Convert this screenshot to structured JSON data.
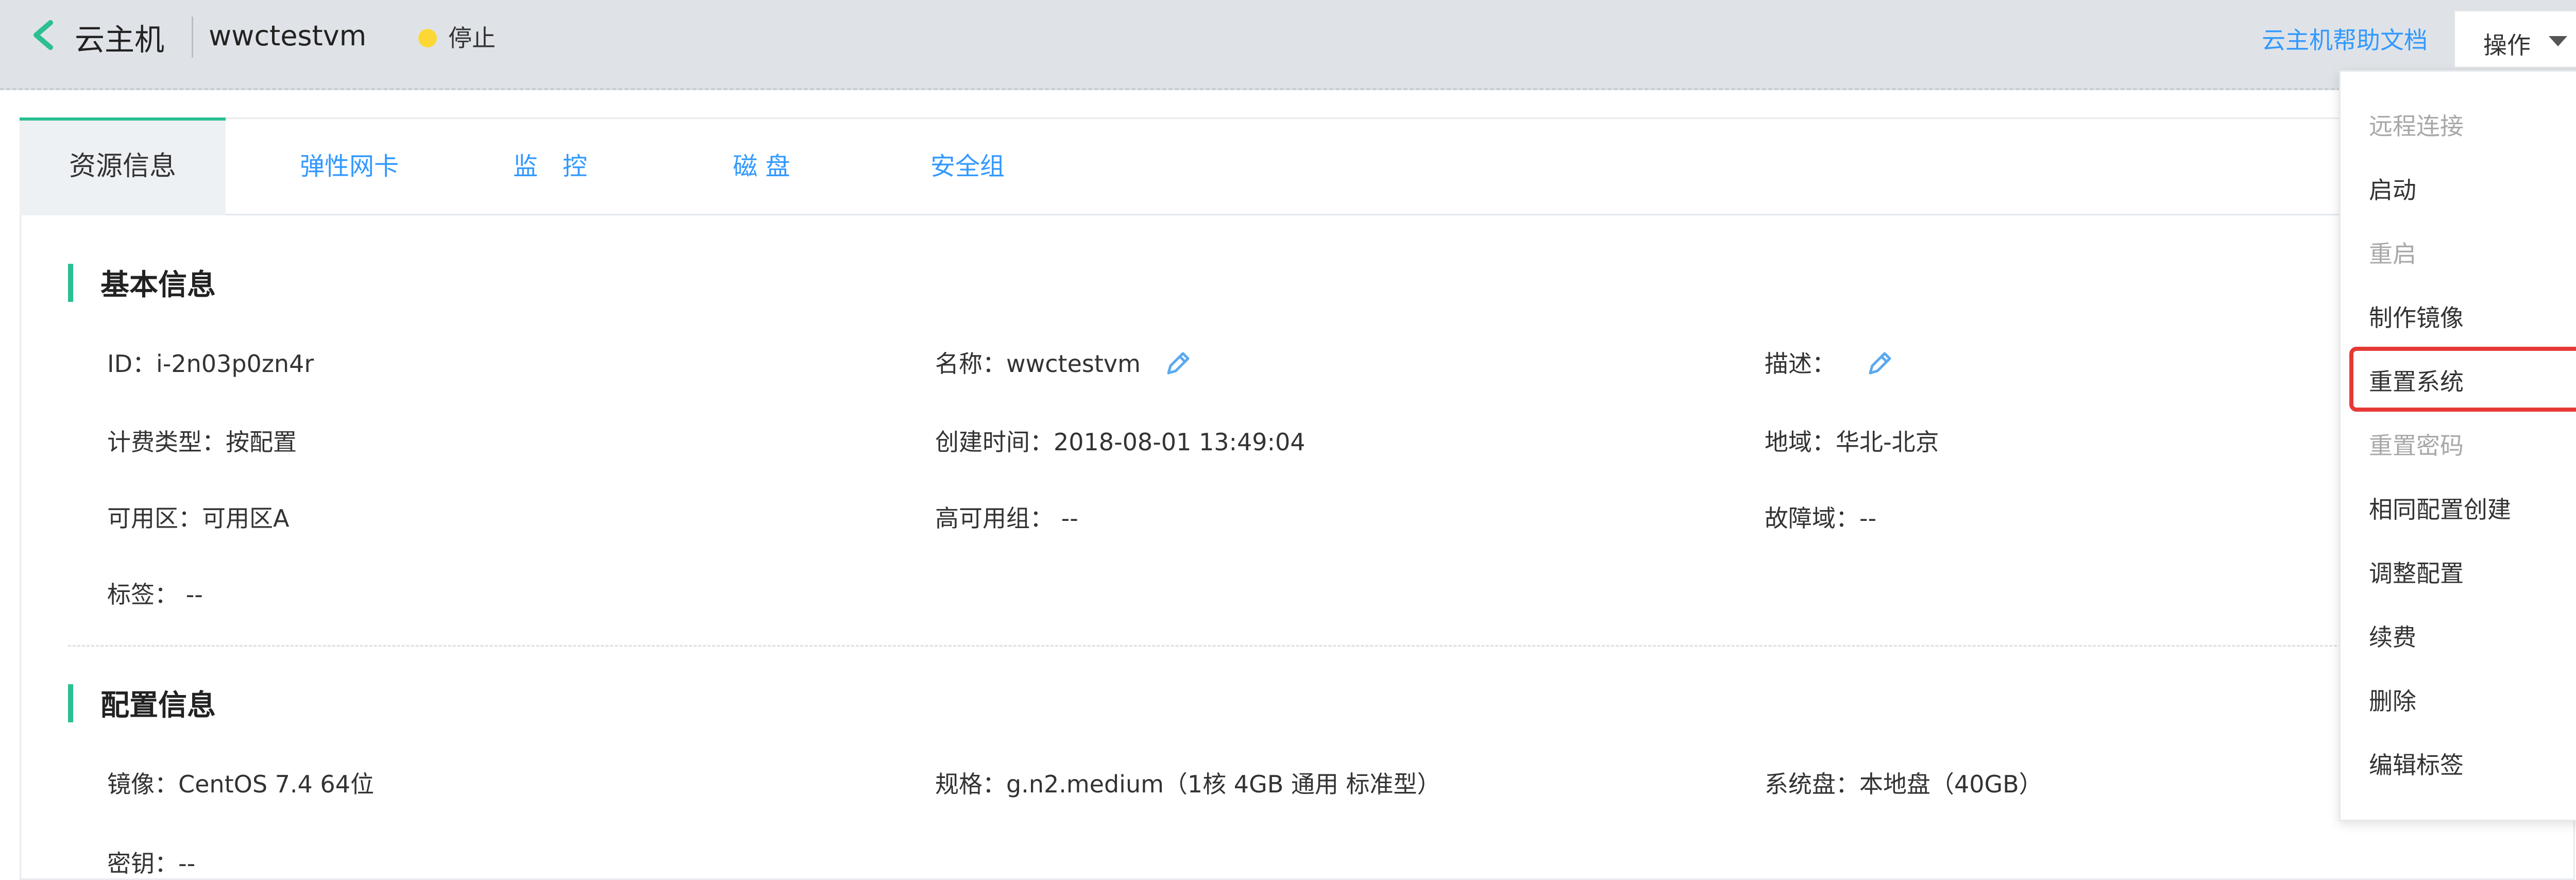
{
  "header": {
    "app_title": "云主机",
    "vm_name": "wwctestvm",
    "status": "停止",
    "help_link": "云主机帮助文档",
    "ops_label": "操作",
    "status_color": "#fdd835"
  },
  "tabs": [
    {
      "label": "资源信息",
      "active": true
    },
    {
      "label": "弹性网卡",
      "active": false
    },
    {
      "label": "监　控",
      "active": false
    },
    {
      "label": "磁 盘",
      "active": false
    },
    {
      "label": "安全组",
      "active": false
    }
  ],
  "basic": {
    "title": "基本信息",
    "id": "ID：i-2n03p0zn4r",
    "name": "名称：wwctestvm",
    "desc": "描述：",
    "billing": "计费类型：按配置",
    "created": "创建时间：2018-08-01 13:49:04",
    "region": "地域：华北-北京",
    "az": "可用区：可用区A",
    "ha_group": "高可用组：  --",
    "fault_domain": "故障域：--",
    "tags": "标签：  --"
  },
  "config": {
    "title": "配置信息",
    "image": "镜像：CentOS 7.4 64位",
    "spec": "规格：g.n2.medium（1核 4GB 通用 标准型）",
    "system_disk": "系统盘：本地盘（40GB）",
    "key": "密钥：--"
  },
  "menu": {
    "items": [
      {
        "label": "远程连接",
        "disabled": true
      },
      {
        "label": "启动",
        "disabled": false
      },
      {
        "label": "重启",
        "disabled": true
      },
      {
        "label": "制作镜像",
        "disabled": false
      },
      {
        "label": "重置系统",
        "disabled": false,
        "highlighted": true
      },
      {
        "label": "重置密码",
        "disabled": true
      },
      {
        "label": "相同配置创建",
        "disabled": false
      },
      {
        "label": "调整配置",
        "disabled": false
      },
      {
        "label": "续费",
        "disabled": false
      },
      {
        "label": "删除",
        "disabled": false
      },
      {
        "label": "编辑标签",
        "disabled": false
      }
    ]
  },
  "colors": {
    "accent": "#2bbf91",
    "link": "#3399ff",
    "highlight": "#e53935"
  }
}
